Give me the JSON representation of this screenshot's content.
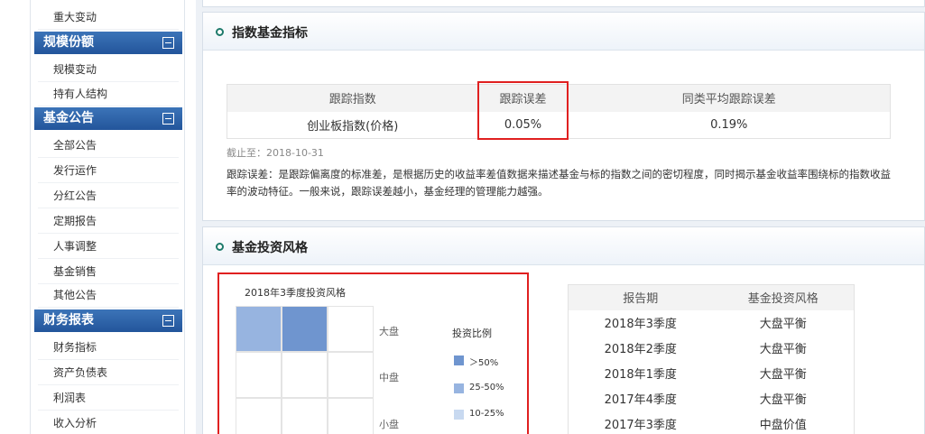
{
  "sidebar": {
    "top_item": "重大变动",
    "groups": [
      {
        "title": "规模份额",
        "items": [
          "规模变动",
          "持有人结构"
        ]
      },
      {
        "title": "基金公告",
        "items": [
          "全部公告",
          "发行运作",
          "分红公告",
          "定期报告",
          "人事调整",
          "基金销售",
          "其他公告"
        ]
      },
      {
        "title": "财务报表",
        "items": [
          "财务指标",
          "资产负债表",
          "利润表",
          "收入分析"
        ]
      }
    ]
  },
  "index_section": {
    "title": "指数基金指标",
    "table": {
      "headers": [
        "跟踪指数",
        "跟踪误差",
        "同类平均跟踪误差"
      ],
      "row": [
        "创业板指数(价格)",
        "0.05%",
        "0.19%"
      ]
    },
    "as_of": "截止至：2018-10-31",
    "note": "跟踪误差：是跟踪偏离度的标准差，是根据历史的收益率差值数据来描述基金与标的指数之间的密切程度，同时揭示基金收益率围绕标的指数收益率的波动特征。一般来说，跟踪误差越小，基金经理的管理能力越强。"
  },
  "style_section": {
    "title": "基金投资风格",
    "chart": {
      "title": "2018年3季度投资风格",
      "row_labels": [
        "大盘",
        "中盘",
        "小盘"
      ],
      "legend_title": "投资比例",
      "legend": [
        {
          "label": "＞50%",
          "color": "#6f95cf"
        },
        {
          "label": "25-50%",
          "color": "#97b4e0"
        },
        {
          "label": "10-25%",
          "color": "#c8d9f0"
        }
      ],
      "cells": [
        [
          "25-50%",
          "＞50%",
          ""
        ],
        [
          "",
          "",
          ""
        ],
        [
          "",
          "",
          ""
        ]
      ]
    },
    "history": {
      "headers": [
        "报告期",
        "基金投资风格"
      ],
      "rows": [
        [
          "2018年3季度",
          "大盘平衡"
        ],
        [
          "2018年2季度",
          "大盘平衡"
        ],
        [
          "2018年1季度",
          "大盘平衡"
        ],
        [
          "2017年4季度",
          "大盘平衡"
        ],
        [
          "2017年3季度",
          "中盘价值"
        ]
      ]
    }
  }
}
